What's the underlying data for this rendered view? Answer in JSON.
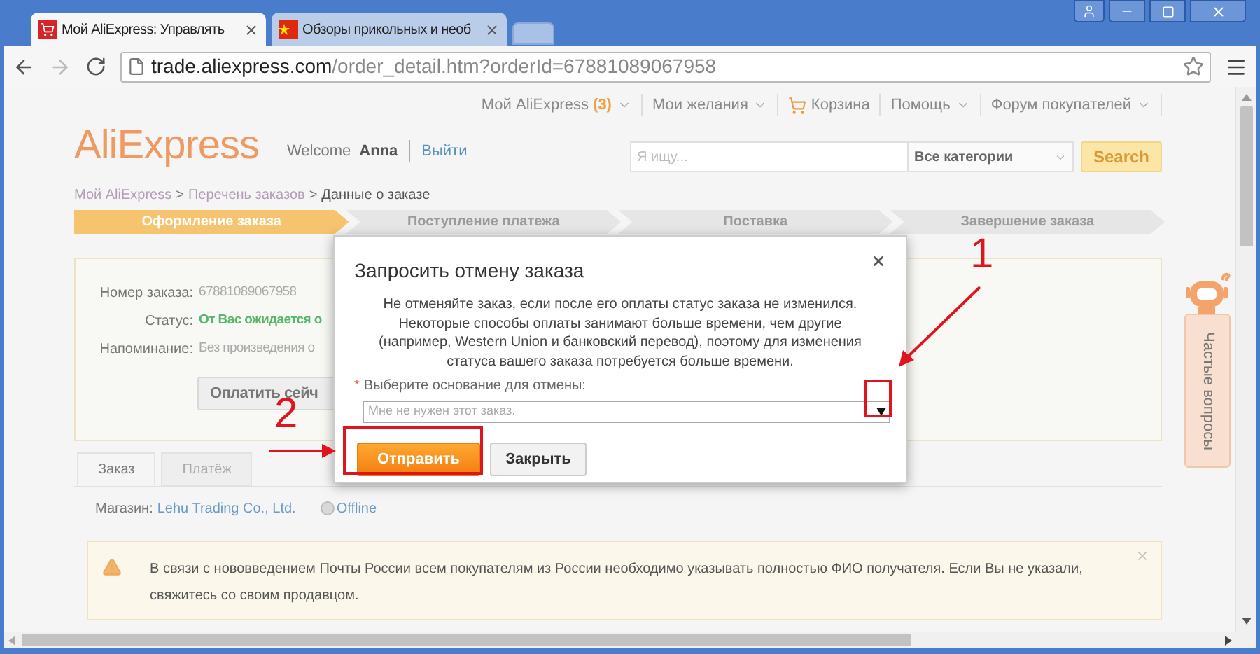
{
  "browser": {
    "tabs": [
      {
        "title": "Мой AliExpress: Управлять",
        "selected": true,
        "kind": "cart"
      },
      {
        "title": "Обзоры прикольных и необ",
        "selected": false,
        "kind": "flag"
      }
    ],
    "address": {
      "host": "trade.aliexpress.com",
      "path": "/order_detail.htm?orderId=67881089067958"
    }
  },
  "header": {
    "top_nav": [
      {
        "label": "Мой AliExpress",
        "count": "(3)",
        "kind": "menu"
      },
      {
        "label": "Мои желания",
        "kind": "menu"
      },
      {
        "label": "Корзина",
        "kind": "cart"
      },
      {
        "label": "Помощь",
        "kind": "menu"
      },
      {
        "label": "Форум покупателей",
        "kind": "menu"
      }
    ],
    "logo": "AliExpress",
    "welcome": "Welcome",
    "user": "Anna",
    "logout": "Выйти",
    "search": {
      "placeholder": "Я ищу...",
      "category": "Все категории",
      "button": "Search"
    }
  },
  "breadcrumb": {
    "items": [
      "Мой AliExpress",
      "Перечень заказов",
      "Данные о заказе"
    ],
    "separator": ">"
  },
  "steps": [
    {
      "label": "Оформление заказа",
      "selected": true
    },
    {
      "label": "Поступление платежа",
      "selected": false
    },
    {
      "label": "Поставка",
      "selected": false
    },
    {
      "label": "Завершение заказа",
      "selected": false
    }
  ],
  "order": {
    "fields": [
      {
        "label": "Номер заказа:",
        "value": "67881089067958",
        "kind": "plain"
      },
      {
        "label": "Статус:",
        "value": "От Вас ожидается о",
        "kind": "status"
      },
      {
        "label": "Напоминание:",
        "value": "Без произведения о",
        "kind": "plain"
      }
    ],
    "pay_button": "Оплатить сейч"
  },
  "tabs": [
    {
      "label": "Заказ",
      "selected": true
    },
    {
      "label": "Платёж",
      "selected": false
    }
  ],
  "store": {
    "label": "Магазин:",
    "name": "Lehu Trading Co., Ltd.",
    "status": "Offline"
  },
  "notice": {
    "text": "В связи с нововведением Почты России всем покупателям из России необходимо указывать полностью ФИО получателя. Если Вы не указали, свяжитесь со своим продавцом."
  },
  "faq": {
    "label": "Частые вопросы"
  },
  "dialog": {
    "title": "Запросить отмену заказа",
    "message": "Не отменяйте заказ, если после его оплаты статус заказа не изменился. Некоторые способы оплаты занимают больше времени, чем другие (например, Western Union и банковский перевод), поэтому для изменения статуса вашего заказа потребуется больше времени.",
    "required_mark": "*",
    "reason_label": "Выберите основание для отмены:",
    "reason_value": "Мне не нужен этот заказ.",
    "buttons": [
      {
        "label": "Отправить",
        "kind": "primary"
      },
      {
        "label": "Закрыть",
        "kind": "secondary"
      }
    ]
  },
  "annotations": [
    {
      "label": "1"
    },
    {
      "label": "2"
    }
  ]
}
